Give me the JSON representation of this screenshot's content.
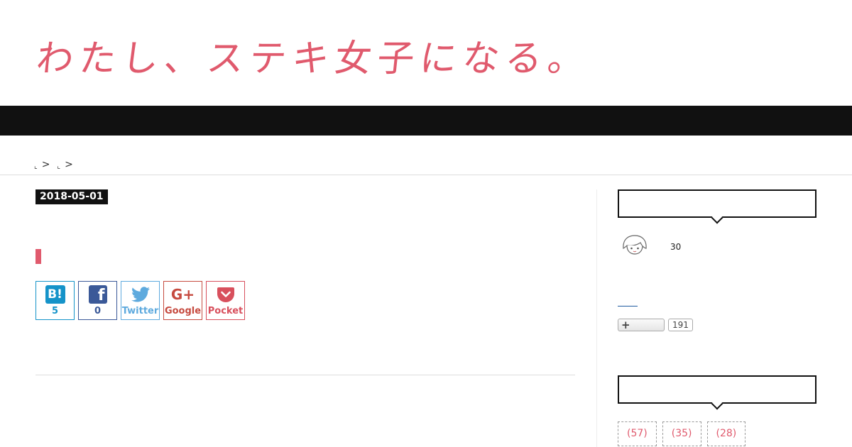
{
  "header": {
    "site_title": "わたし、ステキ女子になる。"
  },
  "breadcrumb": {
    "separators": [
      ">",
      ">"
    ]
  },
  "post": {
    "date": "2018-05-01"
  },
  "share": {
    "hatena": {
      "icon": "B!",
      "count": "5"
    },
    "facebook": {
      "icon": "f",
      "count": "0"
    },
    "twitter": {
      "label": "Twitter"
    },
    "google": {
      "icon": "G+",
      "label": "Google"
    },
    "pocket": {
      "label": "Pocket"
    }
  },
  "sidebar": {
    "profile": {
      "age": "30"
    },
    "follow": {
      "button_icon": "+",
      "count": "191"
    },
    "categories": [
      "(57)",
      "(35)",
      "(28)"
    ]
  },
  "colors": {
    "accent": "#e05a6d",
    "nav": "#111111"
  }
}
